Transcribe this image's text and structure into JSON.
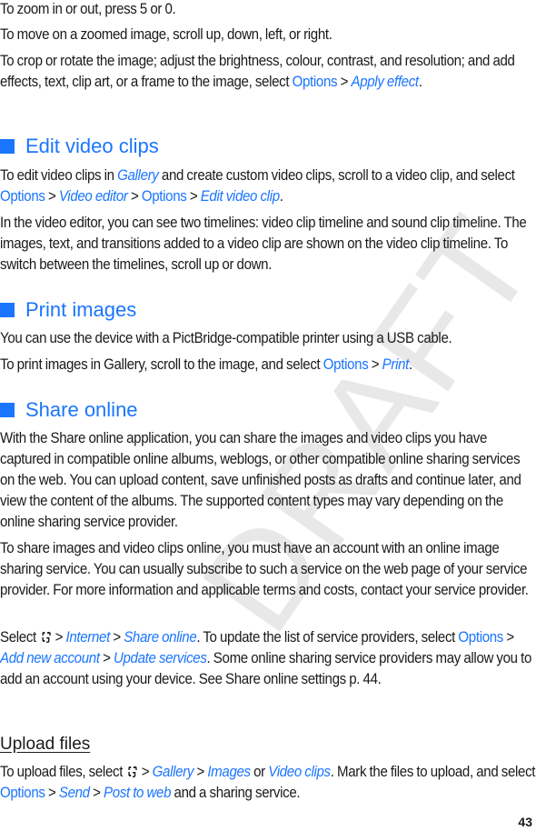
{
  "watermark": "DRAFT",
  "page_number": "43",
  "intro": {
    "p1": "To zoom in or out, press 5 or 0.",
    "p2": "To move on a zoomed image, scroll up, down, left, or right.",
    "p3_a": "To crop or rotate the image; adjust the brightness, colour, contrast, and resolution; and add effects, text, clip art, or a frame to the image, select ",
    "p3_options": "Options",
    "p3_sep": " > ",
    "p3_apply": "Apply effect",
    "p3_end": "."
  },
  "edit_video": {
    "heading": "Edit video clips",
    "p1_a": "To edit video clips in ",
    "p1_gallery": "Gallery",
    "p1_b": " and create custom video clips, scroll to a video clip, and select ",
    "p1_options1": "Options",
    "sep": " > ",
    "p1_video_editor": "Video editor",
    "p1_options2": "Options",
    "p1_edit_clip": "Edit video clip",
    "p1_end": ".",
    "p2": "In the video editor, you can see two timelines: video clip timeline and sound clip timeline. The images, text, and transitions added to a video clip are shown on the video clip timeline. To switch between the timelines, scroll up or down."
  },
  "print_images": {
    "heading": "Print images",
    "p1": "You can use the device with a PictBridge-compatible printer using a USB cable.",
    "p2_a": "To print images in Gallery, scroll to the image, and select ",
    "p2_options": "Options",
    "sep": " > ",
    "p2_print": "Print",
    "p2_end": "."
  },
  "share_online": {
    "heading": "Share online",
    "p1": "With the Share online application, you can share the images and video clips you have captured in compatible online albums, weblogs, or other compatible online sharing services on the web. You can upload content, save unfinished posts as drafts and continue later, and view the content of the albums. The supported content types may vary depending on the online sharing service provider.",
    "p2": "To share images and video clips online, you must have an account with an online image sharing service. You can usually subscribe to such a service on the web page of your service provider. For more information and applicable terms and costs, contact your service provider.",
    "p3_a": "Select ",
    "sep": " > ",
    "p3_internet": "Internet",
    "p3_share_online": "Share online",
    "p3_b": ". To update the list of service providers, select ",
    "p3_options": "Options",
    "p3_add_account": "Add new account",
    "p3_update": "Update services",
    "p3_c": ". Some online sharing service providers may allow you to add an account using your device. See Share online settings p. 44."
  },
  "upload_files": {
    "heading": "Upload files",
    "p1_a": "To upload files, select ",
    "sep": " > ",
    "p1_gallery": "Gallery",
    "p1_images": "Images",
    "p1_or": " or ",
    "p1_video_clips": "Video clips",
    "p1_b": ". Mark the files to upload, and select ",
    "p1_options": "Options",
    "p1_send": "Send",
    "p1_post": "Post to web",
    "p1_c": " and a sharing service."
  },
  "icons": {
    "menu_key": "menu-key-icon"
  },
  "colors": {
    "accent": "#1a75ff",
    "text": "#1a1a1a"
  }
}
